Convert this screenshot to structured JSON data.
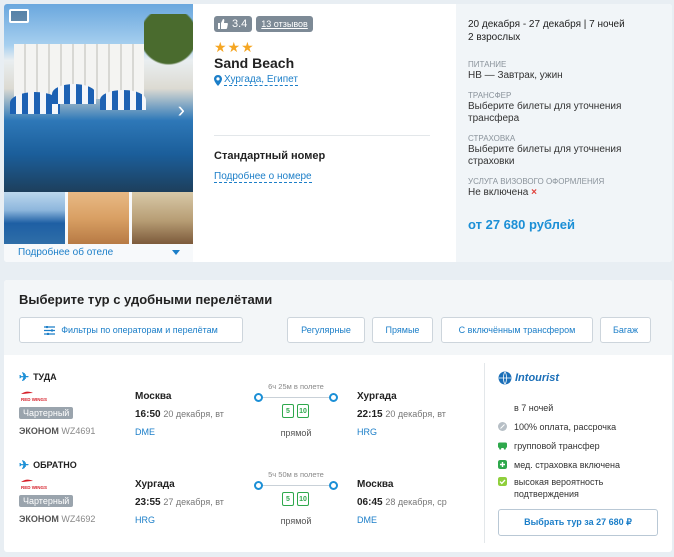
{
  "hotel": {
    "rating": "3.4",
    "reviews": "13 отзывов",
    "stars": "★★★",
    "name": "Sand Beach",
    "location": "Хургада, Египет",
    "room_type": "Стандартный номер",
    "room_link": "Подробнее о номере",
    "about_link": "Подробнее об отеле"
  },
  "trip": {
    "dates": "20 декабря - 27 декабря | 7 ночей",
    "guests": "2 взрослых",
    "meal_label": "ПИТАНИЕ",
    "meal_value": "HB — Завтрак, ужин",
    "transfer_label": "ТРАНСФЕР",
    "transfer_value": "Выберите билеты для уточнения трансфера",
    "insurance_label": "СТРАХОВКА",
    "insurance_value": "Выберите билеты для уточнения страховки",
    "visa_label": "УСЛУГА ВИЗОВОГО ОФОРМЛЕНИЯ",
    "visa_value": "Не включена",
    "visa_cross": "×",
    "price": "от 27 680 рублей"
  },
  "tours": {
    "title": "Выберите тур с удобными перелётами",
    "filters": {
      "operators": "Фильтры по операторам и перелётам",
      "regular": "Регулярные",
      "direct": "Прямые",
      "transfer": "С включённым трансфером",
      "baggage": "Багаж"
    }
  },
  "flights": {
    "outbound": {
      "direction": "ТУДА",
      "airline": "RED WINGS",
      "charter": "Чартерный",
      "class": "ЭКОНОМ",
      "number": "WZ4691",
      "from_city": "Москва",
      "from_time": "16:50",
      "from_date": "20 декабря, вт",
      "from_airport": "DME",
      "duration": "6ч 25м в полете",
      "baggage": "5",
      "hand": "10",
      "direct": "прямой",
      "to_city": "Хургада",
      "to_time": "22:15",
      "to_date": "20 декабря, вт",
      "to_airport": "HRG"
    },
    "return": {
      "direction": "ОБРАТНО",
      "airline": "RED WINGS",
      "charter": "Чартерный",
      "class": "ЭКОНОМ",
      "number": "WZ4692",
      "from_city": "Хургада",
      "from_time": "23:55",
      "from_date": "27 декабря, вт",
      "from_airport": "HRG",
      "duration": "5ч 50м в полете",
      "baggage": "5",
      "hand": "10",
      "direct": "прямой",
      "to_city": "Москва",
      "to_time": "06:45",
      "to_date": "28 декабря, ср",
      "to_airport": "DME"
    }
  },
  "operator": {
    "name": "Intourist",
    "features": [
      "в 7 ночей",
      "100% оплата, рассрочка",
      "групповой трансфер",
      "мед. страховка включена",
      "высокая вероятность подтверждения"
    ],
    "select_button": "Выбрать тур за 27 680 ₽"
  },
  "colors": {
    "accent": "#1b7ec8",
    "price": "#1b8fd6",
    "star": "#f5a623",
    "green": "#2ea84c"
  }
}
